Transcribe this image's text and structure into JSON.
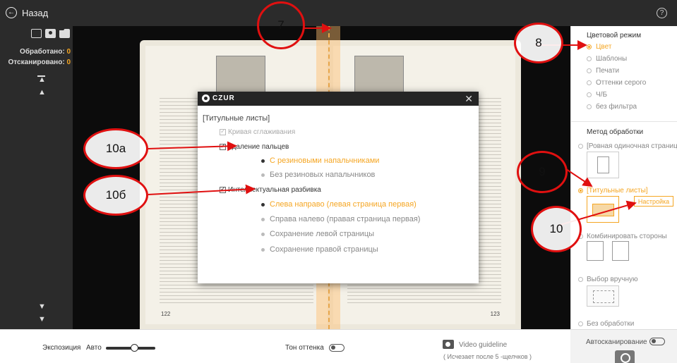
{
  "topbar": {
    "back_label": "Назад",
    "back_icon": "arrow-left-circle-icon",
    "help_icon": "question-circle-icon"
  },
  "left_panel": {
    "processed_label": "Обработано:",
    "processed_value": "0",
    "scanned_label": "Отсканировано:",
    "scanned_value": "0"
  },
  "viewport": {
    "page_left_number": "122",
    "page_right_number": "123"
  },
  "right_panel": {
    "color_mode_title": "Цветовой режим",
    "color_modes": [
      {
        "label": "Цвет",
        "selected": true
      },
      {
        "label": "Шаблоны",
        "selected": false
      },
      {
        "label": "Печати",
        "selected": false
      },
      {
        "label": "Оттенки серого",
        "selected": false
      },
      {
        "label": "Ч/Б",
        "selected": false
      },
      {
        "label": "без фильтра",
        "selected": false
      }
    ],
    "method_title": "Метод обработки",
    "methods": [
      {
        "label": "[Ровная одиночная страница]",
        "selected": false
      },
      {
        "label": "[Титульные листы]",
        "selected": true
      },
      {
        "label": "Комбинировать стороны",
        "selected": false
      },
      {
        "label": "Выбор вручную",
        "selected": false
      },
      {
        "label": "Без обработки",
        "selected": false
      }
    ],
    "settings_button": "Настройка"
  },
  "bottom_bar": {
    "exposure_label": "Экспозиция",
    "exposure_mode": "Авто",
    "tone_label": "Тон оттенка",
    "video_guideline": "Video guideline",
    "video_guideline_sub": "( Исчезает после 5 -щелчков )",
    "autoscan_label": "Автосканирование"
  },
  "dialog": {
    "brand": "CZUR",
    "title": "[Титульные листы]",
    "curve_smoothing": "Кривая сглаживания",
    "finger_removal": "Удаление пальцев",
    "finger_options": [
      {
        "label": "С резиновыми напальчниками",
        "selected": true
      },
      {
        "label": "Без резиновых напальчников",
        "selected": false
      }
    ],
    "smart_split": "Интеллектуальная разбивка",
    "split_options": [
      {
        "label": "Слева направо (левая страница первая)",
        "selected": true
      },
      {
        "label": "Справа налево (правая страница первая)",
        "selected": false
      },
      {
        "label": "Сохранение левой страницы",
        "selected": false
      },
      {
        "label": "Сохранение правой страницы",
        "selected": false
      }
    ]
  },
  "annotations": {
    "a7": "7",
    "a8": "8",
    "a9": "9",
    "a10": "10",
    "a10a": "10а",
    "a10b": "10б"
  },
  "colors": {
    "accent": "#f5a623",
    "annotation": "#e01010",
    "dark_bar": "#2b2b2b"
  }
}
